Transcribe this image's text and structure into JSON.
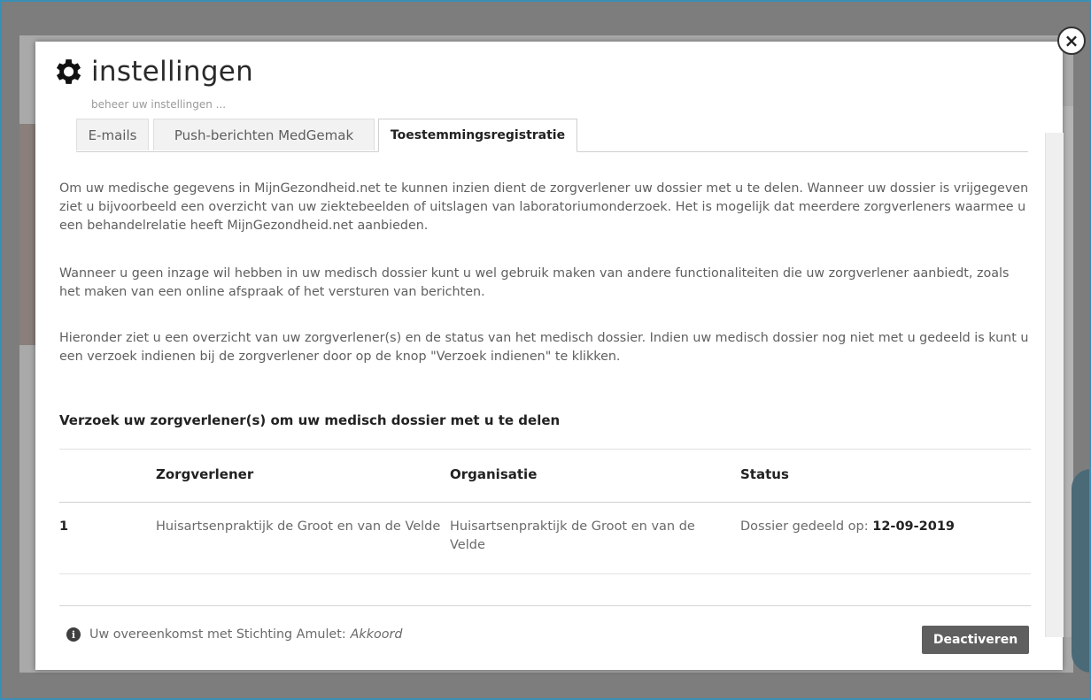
{
  "modal": {
    "title": "instellingen",
    "subtitle": "beheer uw instellingen ...",
    "close_symbol": "×",
    "tabs": [
      {
        "label": "E-mails",
        "active": false
      },
      {
        "label": "Push-berichten MedGemak",
        "active": false
      },
      {
        "label": "Toestemmingsregistratie",
        "active": true
      }
    ],
    "paragraphs": [
      "Om uw medische gegevens in MijnGezondheid.net te kunnen inzien dient de zorgverlener uw dossier met u te delen. Wanneer uw dossier is vrijgegeven ziet u bijvoorbeeld een overzicht van uw ziektebeelden of uitslagen van laboratoriumonderzoek. Het is mogelijk dat meerdere zorgverleners waarmee u een behandelrelatie heeft MijnGezondheid.net aanbieden.",
      "Wanneer u geen inzage wil hebben in uw medisch dossier kunt u wel gebruik maken van andere functionaliteiten die uw zorgverlener aanbiedt, zoals het maken van een online afspraak of het versturen van berichten.",
      "Hieronder ziet u een overzicht van uw zorgverlener(s) en de status van het medisch dossier. Indien uw medisch dossier nog niet met u gedeeld is kunt u een verzoek indienen bij de zorgverlener door op de knop \"Verzoek indienen\" te klikken."
    ],
    "section_title": "Verzoek uw zorgverlener(s) om uw medisch dossier met u te delen",
    "table": {
      "headers": [
        "Zorgverlener",
        "Organisatie",
        "Status"
      ],
      "rows": [
        {
          "index": "1",
          "zorgverlener": "Huisartsenpraktijk de Groot en van de Velde",
          "organisatie": "Huisartsenpraktijk de Groot en van de Velde",
          "status_prefix": "Dossier gedeeld op:",
          "status_date": "12-09-2019"
        }
      ]
    },
    "footer": {
      "info_icon": "info-icon",
      "agreement_text": "Uw overeenkomst met Stichting Amulet:",
      "agreement_status": "Akkoord",
      "button_label": "Deactiveren"
    }
  },
  "colors": {
    "overlay": "#7d7d7d",
    "button": "#5f5f5f",
    "text": "#5f5f5f",
    "heading": "#222222"
  }
}
